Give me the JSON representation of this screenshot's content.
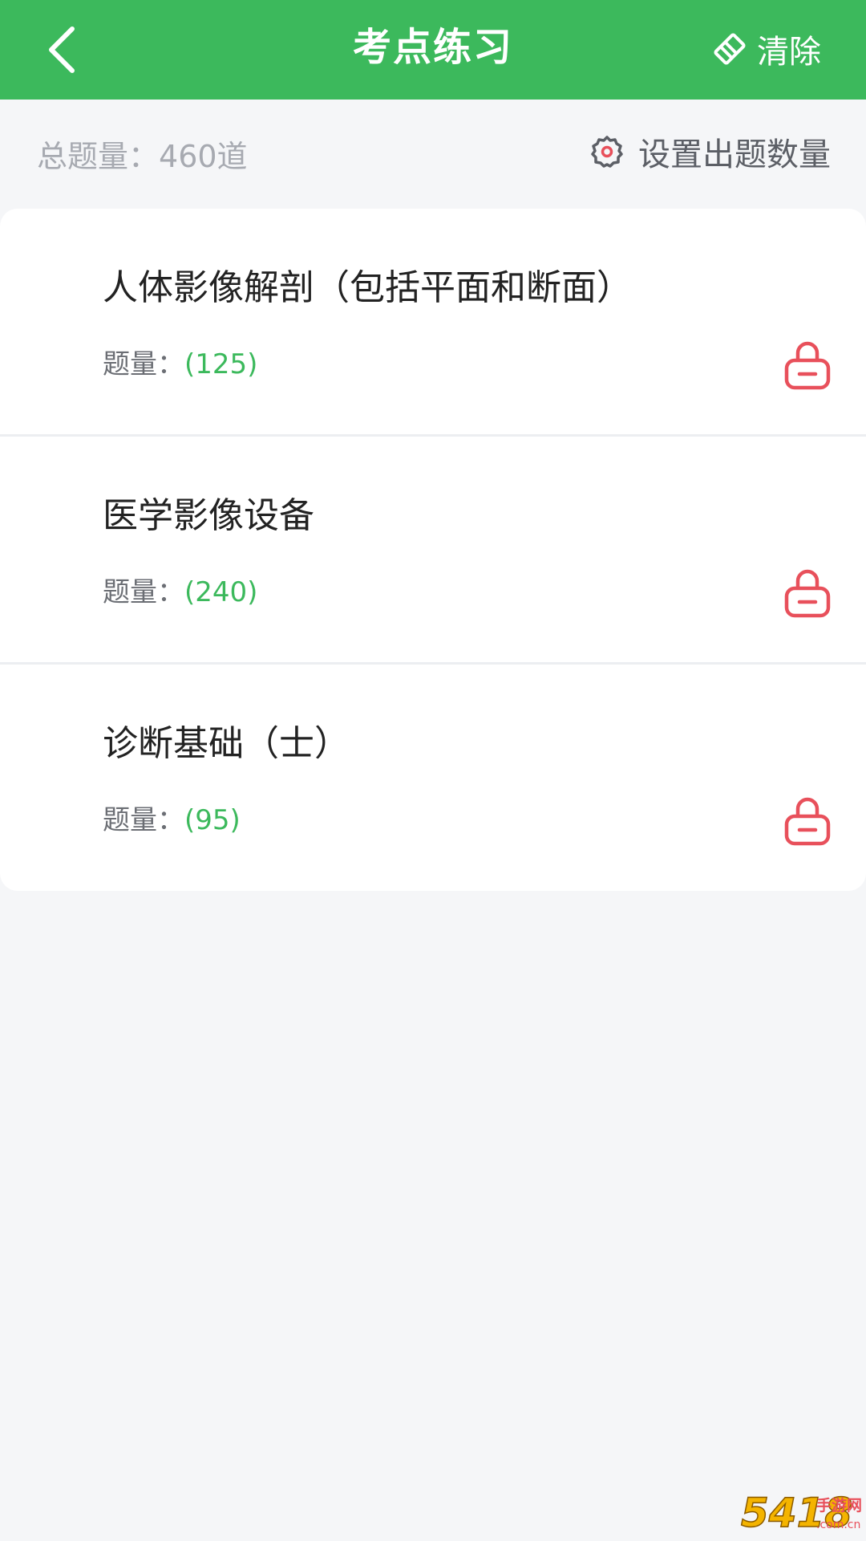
{
  "header": {
    "title": "考点练习",
    "clear_label": "清除"
  },
  "summary": {
    "total_label": "总题量：",
    "total_value": "460道",
    "settings_label": "设置出题数量"
  },
  "items": [
    {
      "title": "人体影像解剖（包括平面和断面）",
      "count_label": "题量：",
      "count": "(125)"
    },
    {
      "title": "医学影像设备",
      "count_label": "题量：",
      "count": "(240)"
    },
    {
      "title": "诊断基础（士）",
      "count_label": "题量：",
      "count": "(95)"
    }
  ],
  "watermark": {
    "text_main": "5418",
    "text_site": "手游网",
    "text_domain": ".com.cn"
  },
  "colors": {
    "brand_green": "#3cb95c",
    "lock_red": "#e8505b",
    "background": "#f5f6f8"
  },
  "icons": {
    "back": "chevron-left-icon",
    "clear": "eraser-icon",
    "settings": "gear-icon",
    "lock": "lock-icon"
  }
}
